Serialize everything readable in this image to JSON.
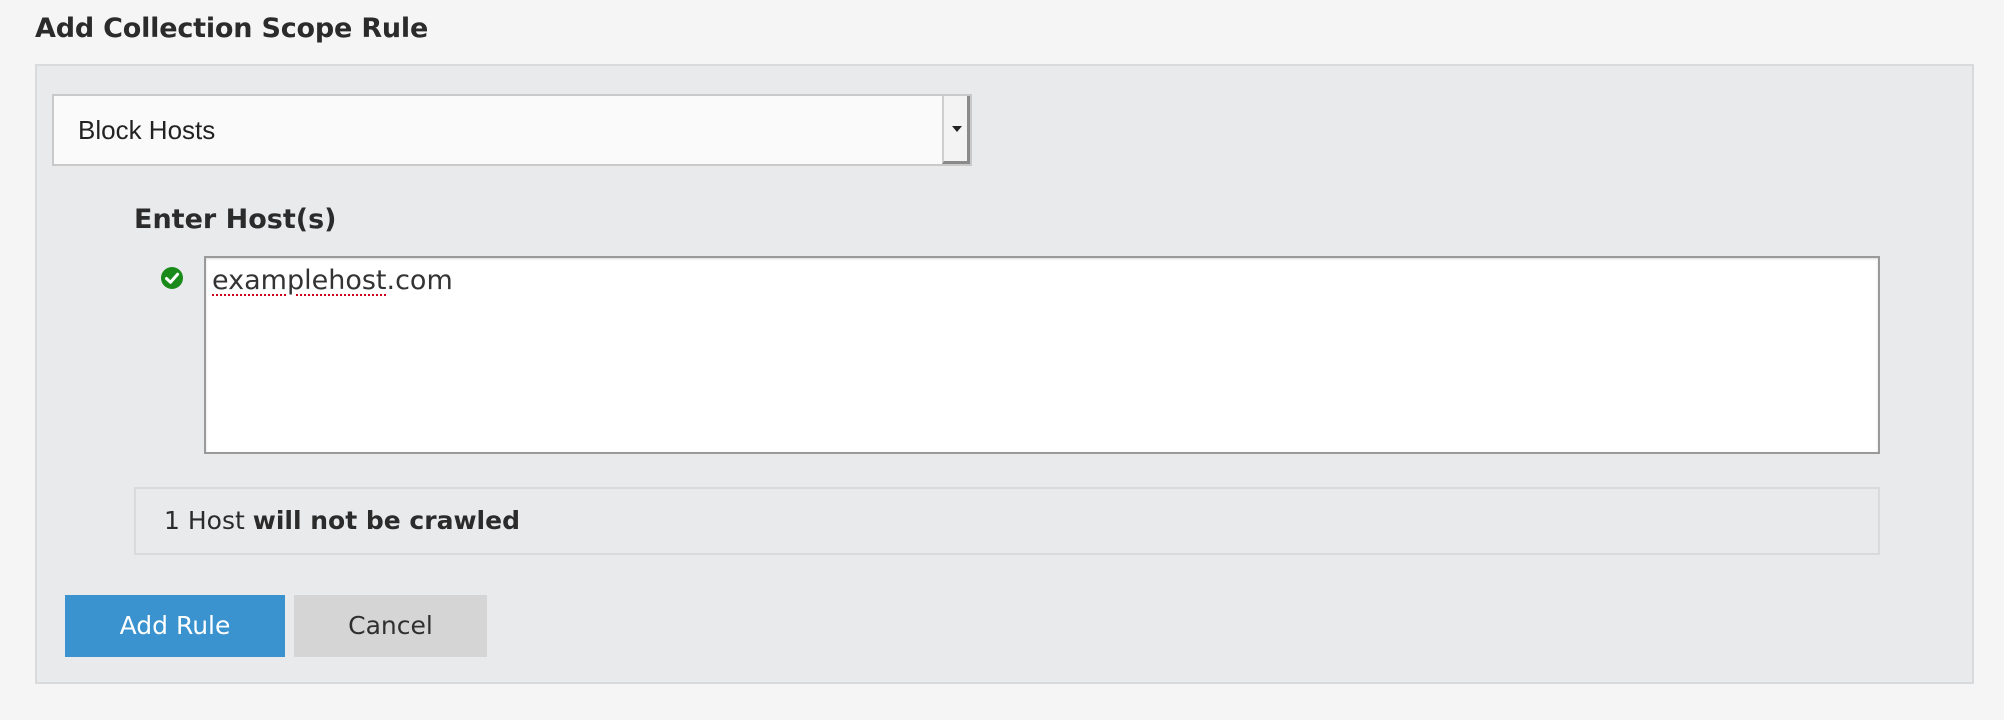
{
  "page": {
    "title": "Add Collection Scope Rule"
  },
  "rule_type_select": {
    "selected": "Block Hosts"
  },
  "hosts_field": {
    "label": "Enter Host(s)",
    "value_misspelled_part": "examplehost",
    "value_rest": ".com",
    "valid_icon": "check-circle-icon",
    "valid_color": "#1a8a1a"
  },
  "summary": {
    "count_text": "1 Host",
    "status_text": "will not be crawled"
  },
  "actions": {
    "add_label": "Add Rule",
    "cancel_label": "Cancel",
    "primary_color": "#3a92cf"
  }
}
